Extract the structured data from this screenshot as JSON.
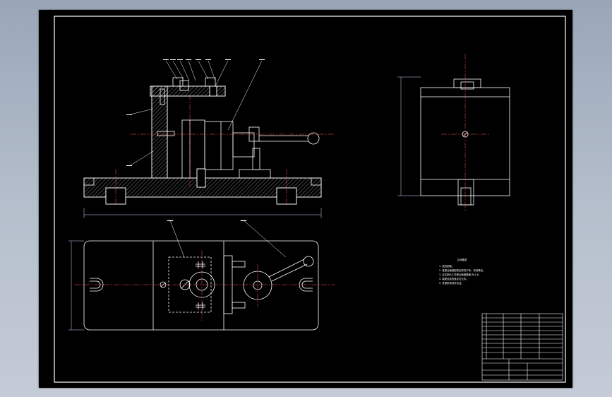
{
  "sheet": {
    "background_color": "#000000",
    "line_color": "#ffffff",
    "dimension_color": "#cfd8ff",
    "window_background": "#a7b3c3"
  },
  "drawing": {
    "views": [
      "front-section-view",
      "side-view",
      "top-view"
    ],
    "balloon_count": 10
  },
  "tech_requirements": {
    "title": "技术要求",
    "lines": [
      "1. 锐边倒钝。",
      "2. 各配合面装配前应清洗干净，涂润滑油。",
      "3. 定位销与工件配合面粗糙度 Ra1.6。",
      "4. 装配后检查各定位元件。",
      "5. 夹紧机构动作灵活。"
    ]
  },
  "title_block": {
    "cells": [
      "",
      "",
      "",
      "",
      "",
      "",
      "",
      "",
      "",
      ""
    ]
  }
}
